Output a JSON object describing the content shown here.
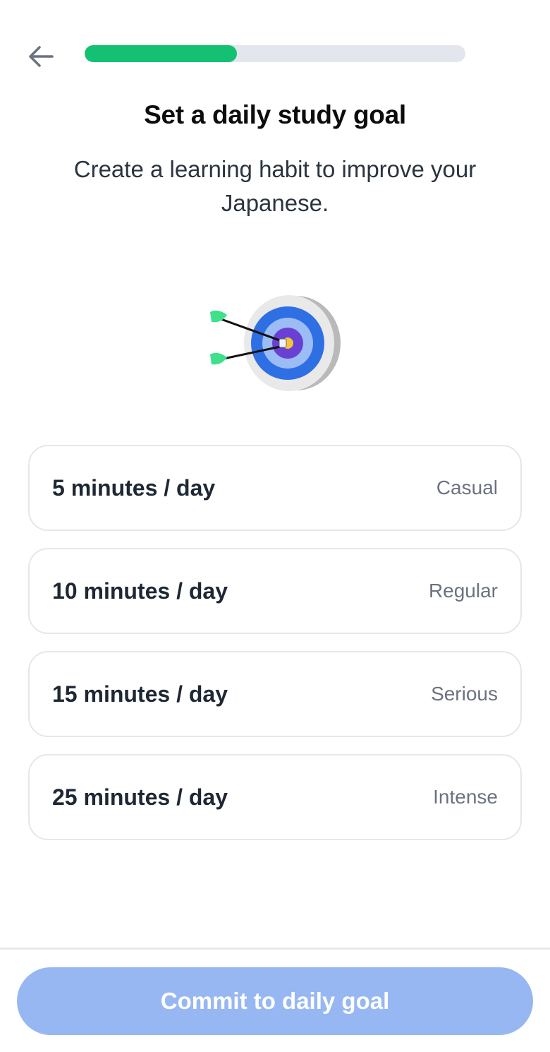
{
  "header": {
    "back_icon": "arrow-left-icon",
    "progress": 0.4,
    "progress_color": "#14c172"
  },
  "main": {
    "title": "Set a daily study goal",
    "subtitle": "Create a learning habit to improve your Japanese.",
    "illustration_icon": "target-with-arrows-icon"
  },
  "options": [
    {
      "label": "5 minutes / day",
      "tag": "Casual"
    },
    {
      "label": "10 minutes / day",
      "tag": "Regular"
    },
    {
      "label": "15 minutes / day",
      "tag": "Serious"
    },
    {
      "label": "25 minutes / day",
      "tag": "Intense"
    }
  ],
  "footer": {
    "commit_label": "Commit to daily goal",
    "commit_color": "#97b7f3"
  }
}
